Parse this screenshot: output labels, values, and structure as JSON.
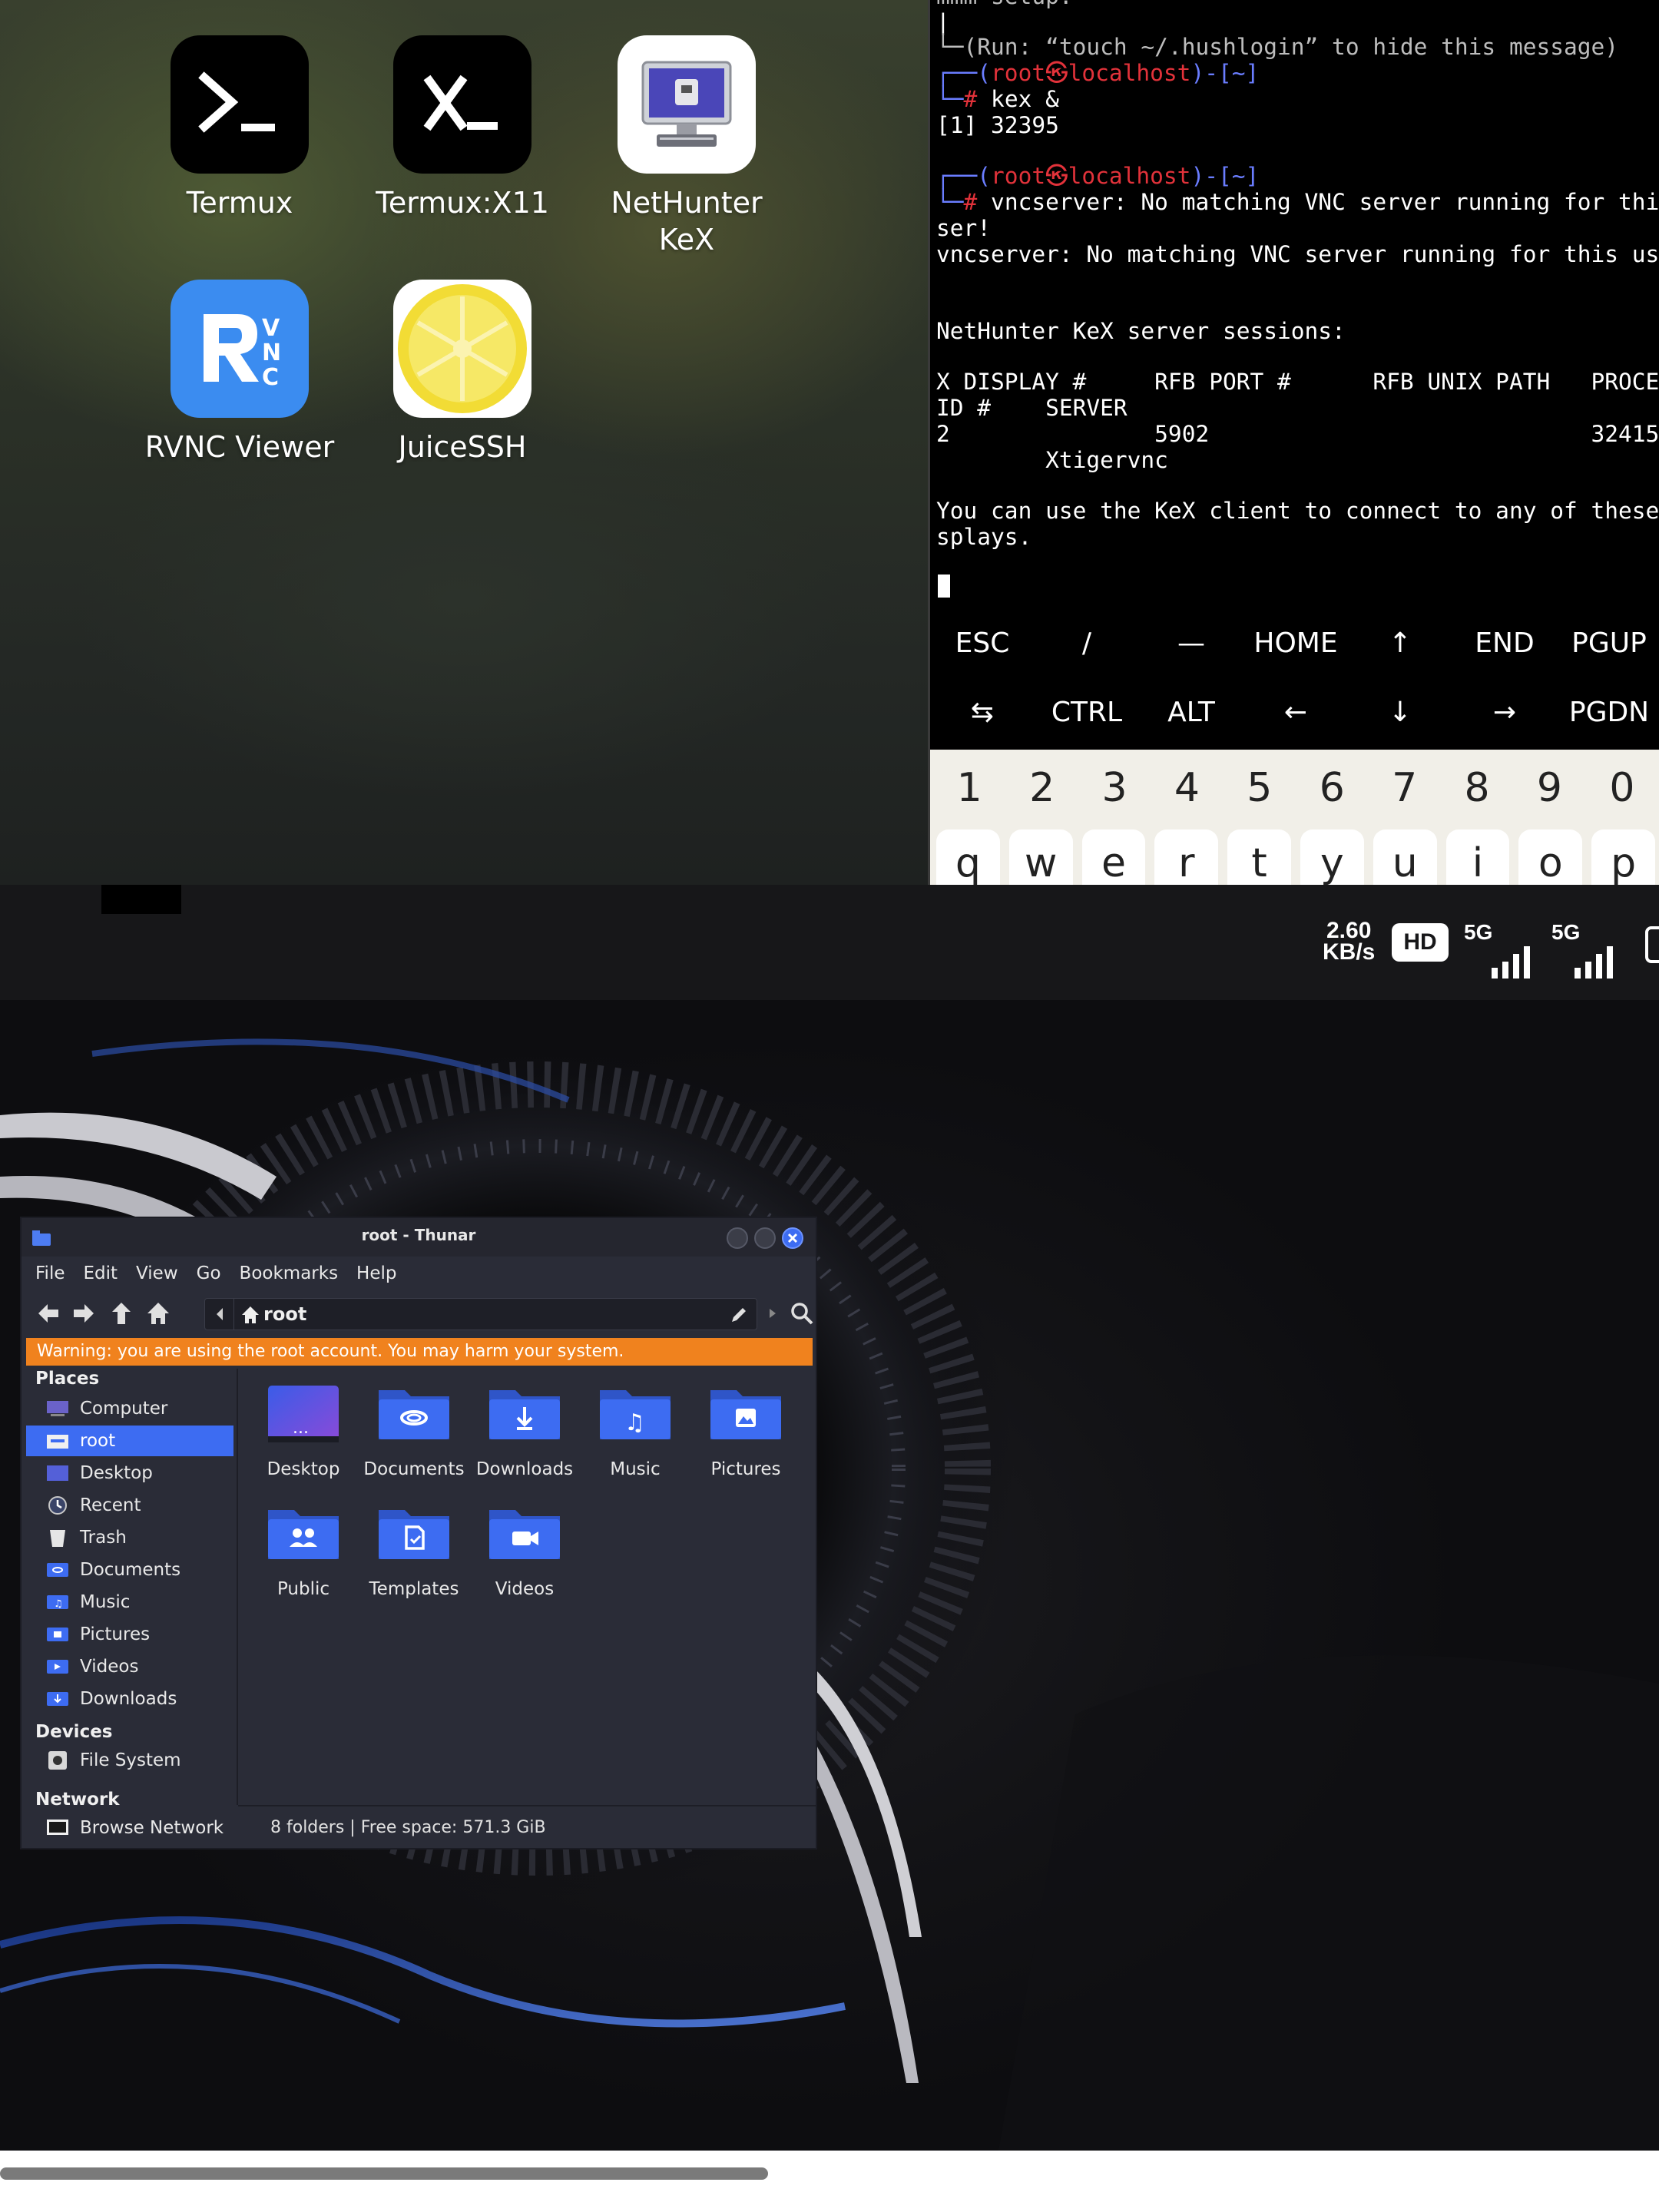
{
  "launcher": {
    "apps": [
      {
        "label": "Termux",
        "icon": "termux-icon"
      },
      {
        "label": "Termux:X11",
        "icon": "termux-x11-icon"
      },
      {
        "label": "NetHunter\nKeX",
        "icon": "nethunter-kex-icon"
      },
      {
        "label": "RVNC Viewer",
        "icon": "rvnc-viewer-icon"
      },
      {
        "label": "JuiceSSH",
        "icon": "juicessh-icon"
      }
    ]
  },
  "terminal": {
    "lines": [
      "mmm setup.",
      "|",
      "└─(Run: “touch ~/.hushlogin” to hide this message)",
      "┌──(root㉿localhost)-[~]",
      "└─# kex &",
      "[1] 32395",
      "",
      "┌──(root㉿localhost)-[~]",
      "└─# vncserver: No matching VNC server running for this u",
      "ser!",
      "vncserver: No matching VNC server running for this user!",
      "",
      "",
      "NetHunter KeX server sessions:",
      "",
      "X DISPLAY #     RFB PORT #      RFB UNIX PATH   PROCESS",
      "ID #    SERVER",
      "2               5902                            32415",
      "        Xtigervnc",
      "",
      "You can use the KeX client to connect to any of these di",
      "splays."
    ],
    "prompt_user": "root㉿localhost",
    "prompt_dir": "~",
    "extra_keys_row1": [
      "ESC",
      "/",
      "—",
      "HOME",
      "↑",
      "END",
      "PGUP"
    ],
    "extra_keys_row2": [
      "⇆",
      "CTRL",
      "ALT",
      "←",
      "↓",
      "→",
      "PGDN"
    ]
  },
  "keyboard": {
    "numbers": [
      "1",
      "2",
      "3",
      "4",
      "5",
      "6",
      "7",
      "8",
      "9",
      "0"
    ],
    "letters": [
      "q",
      "w",
      "e",
      "r",
      "t",
      "y",
      "u",
      "i",
      "o",
      "p"
    ]
  },
  "status_bar": {
    "speed_value": "2.60",
    "speed_unit": "KB/s",
    "hd_badge": "HD",
    "network1": "5G",
    "network2": "5G"
  },
  "thunar": {
    "title": "root - Thunar",
    "menu": [
      "File",
      "Edit",
      "View",
      "Go",
      "Bookmarks",
      "Help"
    ],
    "path": "root",
    "warning": "Warning: you are using the root account. You may harm your system.",
    "places_header": "Places",
    "places": [
      {
        "label": "Computer",
        "icon": "computer-icon"
      },
      {
        "label": "root",
        "icon": "home-folder-icon",
        "active": true
      },
      {
        "label": "Desktop",
        "icon": "desktop-folder-icon"
      },
      {
        "label": "Recent",
        "icon": "recent-icon"
      },
      {
        "label": "Trash",
        "icon": "trash-icon"
      },
      {
        "label": "Documents",
        "icon": "documents-folder-icon"
      },
      {
        "label": "Music",
        "icon": "music-folder-icon"
      },
      {
        "label": "Pictures",
        "icon": "pictures-folder-icon"
      },
      {
        "label": "Videos",
        "icon": "videos-folder-icon"
      },
      {
        "label": "Downloads",
        "icon": "downloads-folder-icon"
      }
    ],
    "devices_header": "Devices",
    "devices": [
      {
        "label": "File System",
        "icon": "drive-icon"
      }
    ],
    "network_header": "Network",
    "network": [
      {
        "label": "Browse Network",
        "icon": "network-icon"
      }
    ],
    "files": [
      {
        "label": "Desktop",
        "icon": "desktop-folder-icon"
      },
      {
        "label": "Documents",
        "icon": "documents-folder-icon"
      },
      {
        "label": "Downloads",
        "icon": "downloads-folder-icon"
      },
      {
        "label": "Music",
        "icon": "music-folder-icon"
      },
      {
        "label": "Pictures",
        "icon": "pictures-folder-icon"
      },
      {
        "label": "Public",
        "icon": "public-folder-icon"
      },
      {
        "label": "Templates",
        "icon": "templates-folder-icon"
      },
      {
        "label": "Videos",
        "icon": "videos-folder-icon"
      }
    ],
    "status": "8 folders  |  Free space: 571.3 GiB"
  },
  "colors": {
    "accent_blue": "#3d6cf2",
    "warning_orange": "#f0821e",
    "prompt_red": "#e2323a",
    "prompt_blue": "#6a7dff"
  }
}
